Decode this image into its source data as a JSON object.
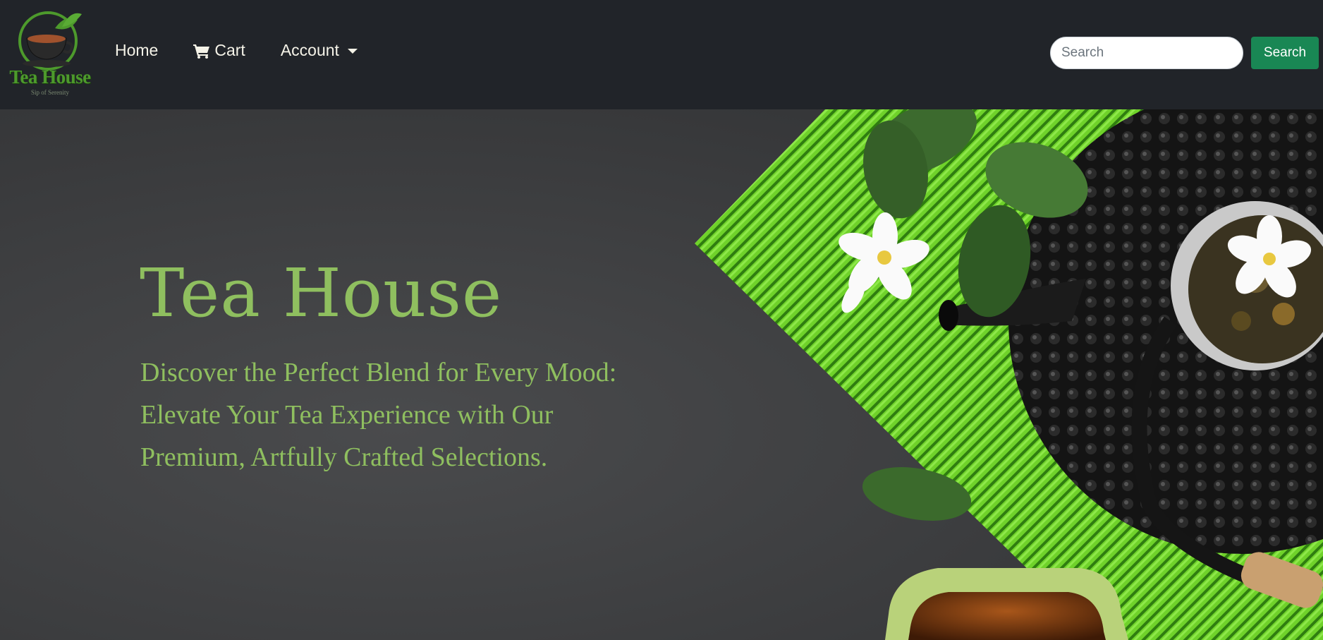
{
  "brand": {
    "name": "Tea House",
    "tagline": "Sip of Serenity"
  },
  "nav": {
    "items": [
      {
        "label": "Home",
        "icon": null
      },
      {
        "label": "Cart",
        "icon": "cart-icon"
      },
      {
        "label": "Account",
        "icon": "caret-down-icon"
      }
    ]
  },
  "search": {
    "placeholder": "Search",
    "value": "",
    "button_label": "Search"
  },
  "hero": {
    "title": "Tea House",
    "subtitle": "Discover the Perfect Blend for Every Mood: Elevate Your Tea Experience with Our Premium, Artfully Crafted Selections."
  },
  "colors": {
    "navbar_bg": "#212429",
    "accent_green": "#8fbf5f",
    "search_button": "#198754",
    "hero_bg": "#3b3c3e"
  }
}
